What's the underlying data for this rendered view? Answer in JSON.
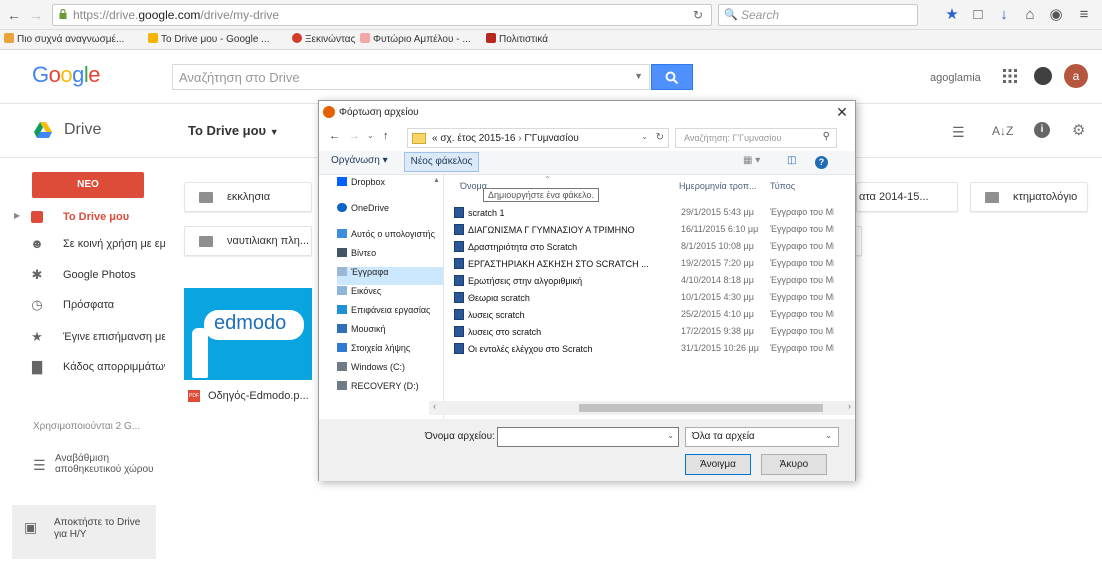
{
  "browser": {
    "url_prefix": "https://drive.",
    "url_domain": "google.com",
    "url_suffix": "/drive/my-drive",
    "search_placeholder": "Search",
    "bookmarks": [
      "Πιο συχνά αναγνωσμέ...",
      "To Drive μου - Google ...",
      "Ξεκινώντας",
      "Φυτώριο Αμπέλου - ...",
      "Πολιτιστικά"
    ]
  },
  "drive": {
    "logo_text": "Google",
    "search_placeholder": "Αναζήτηση στο Drive",
    "username": "agoglamia",
    "avatar_letter": "a",
    "product_title": "Drive",
    "location_title": "To Drive μου",
    "new_button": "ΝΕΟ",
    "sidebar": [
      {
        "label": "To Drive μου",
        "icon": "drive-folder-icon"
      },
      {
        "label": "Σε κοινή χρήση με εμένα",
        "icon": "shared-icon"
      },
      {
        "label": "Google Photos",
        "icon": "photos-icon"
      },
      {
        "label": "Πρόσφατα",
        "icon": "clock-icon"
      },
      {
        "label": "Έγινε επισήμανση με αστέρι",
        "icon": "star-icon"
      },
      {
        "label": "Κάδος απορριμμάτων",
        "icon": "trash-icon"
      }
    ],
    "quota_text": "Χρησιμοποιούνται 2 G...",
    "upgrade_text": "Αναβάθμιση αποθηκευτικού χώρου",
    "get_drive_text": "Αποκτήστε το Drive για Η/Υ",
    "folders": [
      "εκκλησια",
      "ναυτιλιακη πλη...",
      "ατα 2014-15...",
      "κτηματολόγιο"
    ],
    "file_card": {
      "thumb_text": "edmodo",
      "name": "Οδηγός-Edmodo.p...",
      "badge": "PDF"
    }
  },
  "dialog": {
    "title": "Φόρτωση αρχείου",
    "breadcrumb_parts": [
      "«",
      "σχ. έτος 2015-16",
      "›",
      "Γ'Γυμνασίου"
    ],
    "search_placeholder": "Αναζήτηση: Γ'Γυμνασίου",
    "organize_label": "Οργάνωση ▾",
    "new_folder_label": "Νέος φάκελος",
    "tooltip": "Δημιουργήστε ένα φάκελο.",
    "tree": [
      {
        "label": "Dropbox",
        "icon": "dropbox-icon",
        "color": "#0061fe"
      },
      {
        "label": "OneDrive",
        "icon": "onedrive-icon",
        "color": "#0a64c8"
      },
      {
        "label": "Αυτός ο υπολογιστής",
        "icon": "computer-icon",
        "color": "#3c8fdc"
      },
      {
        "label": "Βίντεο",
        "icon": "video-icon",
        "color": "#435466"
      },
      {
        "label": "Έγγραφα",
        "icon": "documents-icon",
        "color": "#9cb6d6",
        "selected": true
      },
      {
        "label": "Εικόνες",
        "icon": "pictures-icon",
        "color": "#8fb5d8"
      },
      {
        "label": "Επιφάνεια εργασίας",
        "icon": "desktop-icon",
        "color": "#1e90d6"
      },
      {
        "label": "Μουσική",
        "icon": "music-icon",
        "color": "#2d6fb8"
      },
      {
        "label": "Στοιχεία λήψης",
        "icon": "downloads-icon",
        "color": "#2f7bd4"
      },
      {
        "label": "Windows (C:)",
        "icon": "drive-c-icon",
        "color": "#6f7b86"
      },
      {
        "label": "RECOVERY (D:)",
        "icon": "drive-d-icon",
        "color": "#6f7b86"
      }
    ],
    "columns": {
      "name": "Όνομα",
      "date": "Ημερομηνία τροπ...",
      "type": "Τύπος"
    },
    "files": [
      {
        "name": "scratch 1",
        "date": "29/1/2015 5:43 μμ",
        "type": "Έγγραφο του Mic"
      },
      {
        "name": "ΔΙΑΓΩΝΙΣΜΑ Γ ΓΥΜΝΑΣΙΟΥ Α ΤΡΙΜΗΝΟ",
        "date": "16/11/2015 6:10 μμ",
        "type": "Έγγραφο του Mic"
      },
      {
        "name": "Δραστηριότητα στο Scratch",
        "date": "8/1/2015 10:08 μμ",
        "type": "Έγγραφο του Mic"
      },
      {
        "name": "ΕΡΓΑΣΤΗΡΙΑΚΗ ΑΣΚΗΣΗ ΣΤΟ SCRATCH ...",
        "date": "19/2/2015 7:20 μμ",
        "type": "Έγγραφο του Mic"
      },
      {
        "name": "Ερωτήσεις στην αλγοριθμική",
        "date": "4/10/2014 8:18 μμ",
        "type": "Έγγραφο του Mic"
      },
      {
        "name": "Θεωρια scratch",
        "date": "10/1/2015 4:30 μμ",
        "type": "Έγγραφο του Mic"
      },
      {
        "name": "λυσεις scratch",
        "date": "25/2/2015 4:10 μμ",
        "type": "Έγγραφο του Mic"
      },
      {
        "name": "λυσεις στο scratch",
        "date": "17/2/2015 9:38 μμ",
        "type": "Έγγραφο του Mic"
      },
      {
        "name": "Οι εντολές ελέγχου στο Scratch",
        "date": "31/1/2015 10:26 μμ",
        "type": "Έγγραφο του Mic"
      }
    ],
    "filename_label": "Όνομα αρχείου:",
    "filename_value": "",
    "filetype_value": "Όλα τα αρχεία",
    "open_label": "Άνοιγμα",
    "cancel_label": "Άκυρο"
  },
  "colors": {
    "accent_blue": "#4d90fe",
    "new_red": "#dd4b39",
    "drive_active_red": "#dd4b39",
    "dialog_select": "#cce8ff"
  }
}
